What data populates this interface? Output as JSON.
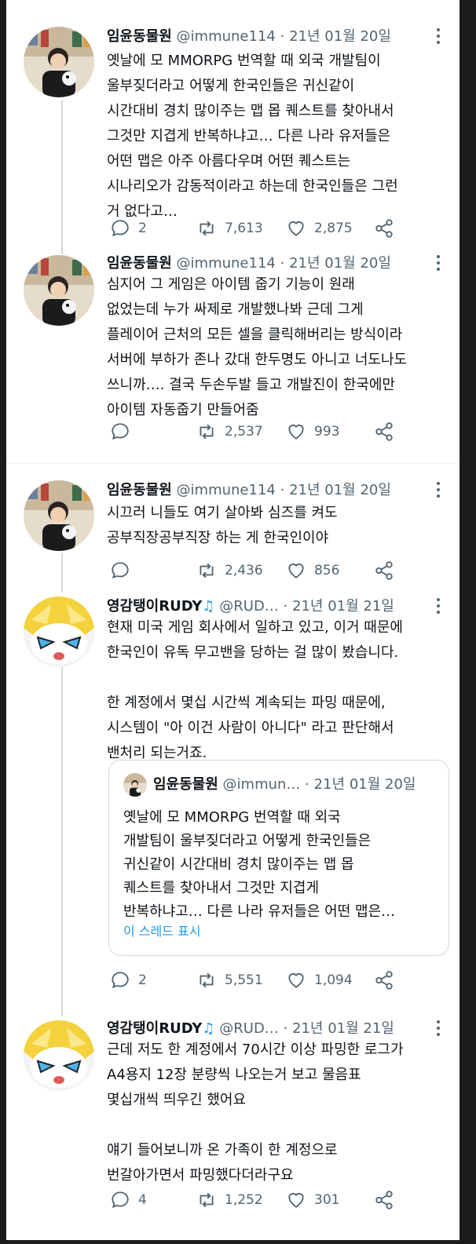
{
  "tweets": [
    {
      "name": "임윤동물원",
      "handle": "@immune114",
      "date": "21년 01월 20일",
      "text": "옛날에 모 MMORPG 번역할 때 외국 개발팀이\n울부짖더라고 어떻게 한국인들은 귀신같이\n시간대비 경치 많이주는 맵 몹 퀘스트를 찾아내서\n그것만 지겹게 반복하냐고… 다른 나라 유저들은\n어떤 맵은 아주 아름다우며 어떤 퀘스트는\n시나리오가 감동적이라고 하는데 한국인들은 그런\n거 없다고…",
      "replies": "2",
      "retweets": "7,613",
      "likes": "2,875"
    },
    {
      "name": "임윤동물원",
      "handle": "@immune114",
      "date": "21년 01월 20일",
      "text": "심지어 그 게임은 아이템 줍기 기능이 원래\n없었는데 누가 싸제로 개발했나봐 근데 그게\n플레이어 근처의 모든 셀을 클릭해버리는 방식이라\n서버에 부하가 존나 갔대 한두명도 아니고 너도나도\n쓰니까…. 결국 두손두발 들고 개발진이 한국에만\n아이템 자동줍기 만들어줌",
      "replies": "",
      "retweets": "2,537",
      "likes": "993"
    },
    {
      "name": "임윤동물원",
      "handle": "@immune114",
      "date": "21년 01월 20일",
      "text": "시끄러 니들도 여기 살아봐 심즈를 켜도\n공부직장공부직장 하는 게 한국인이야",
      "replies": "",
      "retweets": "2,436",
      "likes": "856"
    },
    {
      "name": "영감탱이RUDY",
      "music": "♫",
      "handle": "@RUD…",
      "date": "21년 01월 21일",
      "text": "현재 미국 게임 회사에서 일하고 있고, 이거 때문에\n한국인이 유독 무고밴을 당하는 걸 많이 봤습니다.\n\n한 계정에서 몇십 시간씩 계속되는 파밍 때문에,\n시스템이 \"아 이건 사람이 아니다\" 라고 판단해서\n밴처리 되는거죠.",
      "replies": "2",
      "retweets": "5,551",
      "likes": "1,094",
      "quote": {
        "name": "임윤동물원",
        "handle": "@immun…",
        "date": "21년 01월 20일",
        "text": "옛날에 모 MMORPG 번역할 때 외국\n개발팀이 울부짖더라고 어떻게 한국인들은\n귀신같이 시간대비 경치 많이주는 맵 몹\n퀘스트를 찾아내서 그것만 지겹게\n반복하냐고… 다른 나라 유저들은 어떤 맵은…",
        "link": "이 스레드 표시"
      }
    },
    {
      "name": "영감탱이RUDY",
      "music": "♫",
      "handle": "@RUD…",
      "date": "21년 01월 21일",
      "text": "근데 저도 한 계정에서 70시간 이상 파밍한 로그가\nA4용지 12장 분량씩 나오는거 보고 물음표\n몇십개씩 띄우긴 했어요\n\n얘기 들어보니까 온 가족이 한 계정으로\n번갈아가면서 파밍했다더라구요",
      "replies": "4",
      "retweets": "1,252",
      "likes": "301"
    }
  ],
  "icons": {
    "more": "more-dots-icon",
    "reply": "reply-icon",
    "retweet": "retweet-icon",
    "like": "heart-icon",
    "share": "share-icon",
    "music": "music-note-icon"
  },
  "colors": {
    "text": "#0f1419",
    "secondary": "#536471",
    "link": "#1d9bf0",
    "border": "#cfd9de"
  }
}
